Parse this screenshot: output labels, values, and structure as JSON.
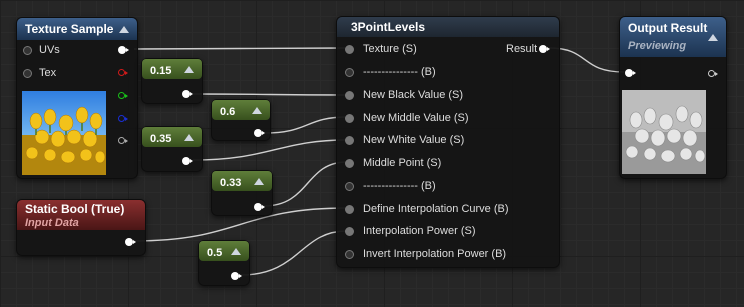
{
  "texture_sample": {
    "title": "Texture Sample",
    "inputs": [
      "UVs",
      "Tex"
    ],
    "channel_colors": [
      "#cccccc",
      "#d11a1a",
      "#19c019",
      "#1a2fd6",
      "#aaaaaa"
    ]
  },
  "constants": [
    {
      "value": "0.15"
    },
    {
      "value": "0.6"
    },
    {
      "value": "0.35"
    },
    {
      "value": "0.33"
    },
    {
      "value": "0.5"
    }
  ],
  "static_bool": {
    "title": "Static Bool (True)",
    "subtitle": "Input Data"
  },
  "levels": {
    "title": "3PointLevels",
    "output_label": "Result",
    "inputs": [
      "Texture (S)",
      "--------------- (B)",
      "New Black Value (S)",
      "New Middle Value (S)",
      "New White Value (S)",
      "Middle Point (S)",
      "--------------- (B)",
      "Define Interpolation Curve (B)",
      "Interpolation Power (S)",
      "Invert Interpolation Power (B)"
    ]
  },
  "output_result": {
    "title": "Output Result",
    "subtitle": "Previewing"
  },
  "colors": {
    "wire": "#cfcfcf",
    "grid": "#262626"
  }
}
